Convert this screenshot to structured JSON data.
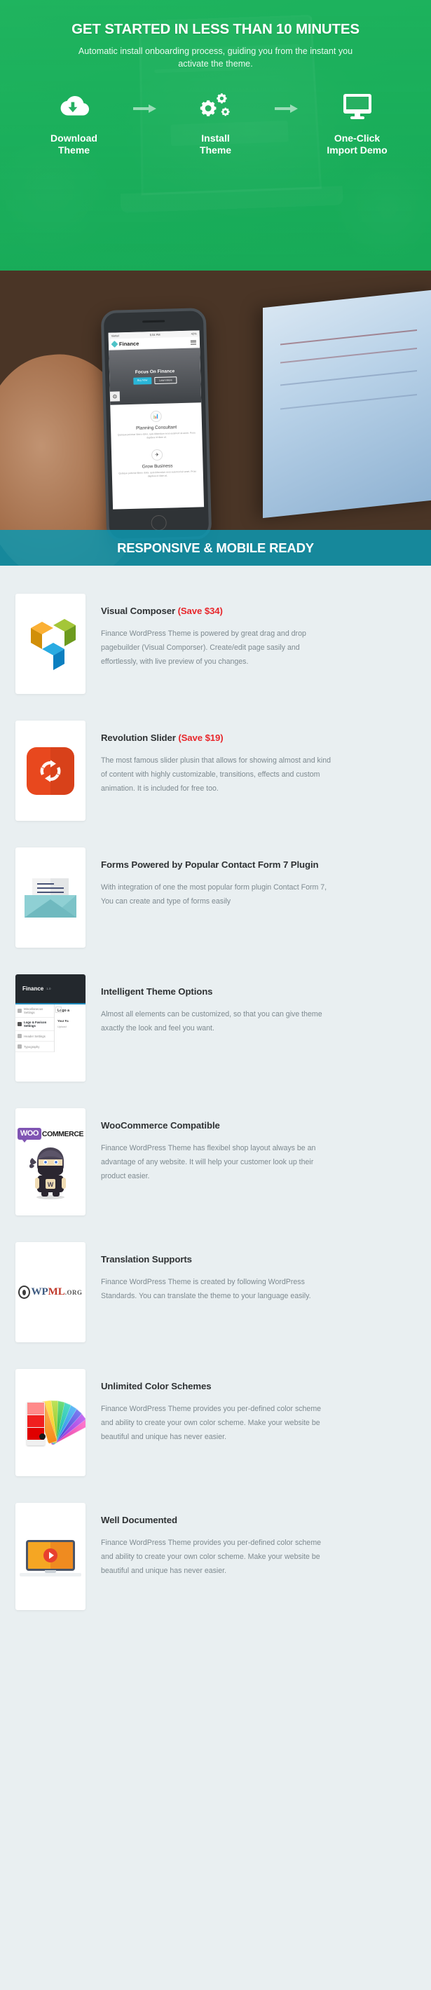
{
  "hero": {
    "title": "GET STARTED IN LESS THAN 10 MINUTES",
    "subtitle": "Automatic install onboarding process, guiding you from the instant you activate the theme.",
    "bg_color": "#20b45f",
    "steps": [
      {
        "icon": "cloud-download-icon",
        "label": "Download\nTheme"
      },
      {
        "icon": "gears-icon",
        "label": "Install\nTheme"
      },
      {
        "icon": "monitor-icon",
        "label": "One-Click\nImport Demo"
      }
    ],
    "arrow_icon": "arrow-right-icon"
  },
  "responsive": {
    "band_text": "RESPONSIVE & MOBILE READY",
    "band_color": "#0e96af",
    "phone": {
      "status_left": "Viettel",
      "status_time": "6:04 PM",
      "status_right": "42%",
      "brand": "Finance",
      "hero_heading": "Focus On Finance",
      "btn_primary": "Buy Now",
      "btn_secondary": "Learn More",
      "blocks": [
        {
          "icon": "chart-icon",
          "heading": "Planning Consultant",
          "text": "Quisque pulvinar libero dolor, quis bibendum eros euismod sit amet. Proin dapibus id diam at."
        },
        {
          "icon": "rocket-icon",
          "heading": "Grow Business",
          "text": "Quisque pulvinar libero dolor, quis bibendum eros euismod sit amet. Proin dapibus id diam at."
        }
      ]
    }
  },
  "features": [
    {
      "art": "visual-composer-logo",
      "title": "Visual Composer ",
      "save": "(Save $34)",
      "desc": "Finance WordPress Theme is powered by great drag and drop pagebuilder (Visual Comporser). Create/edit page sasily and effortlessly, with live preview of you changes."
    },
    {
      "art": "revolution-slider-logo",
      "title": "Revolution Slider ",
      "save": "(Save $19)",
      "desc": "The most famous slider plusin that allows for showing almost and kind of content with highly customizable, transitions, effects and custom animation. It is included for free too."
    },
    {
      "art": "envelope-icon",
      "title": "Forms Powered by Popular Contact Form 7 Plugin",
      "save": "",
      "desc": "With integration of one the most popular form plugin Contact Form 7, You can create and type of forms easily"
    },
    {
      "art": "theme-options-screenshot",
      "title": "Intelligent Theme Options",
      "save": "",
      "desc": "Almost all elements can be customized, so that you can give theme axactly the look and feel you want.",
      "screenshot": {
        "brand": "Finance",
        "version": "1.0",
        "nav": [
          "Miscellaneous Settings",
          "Logo & Favicon Settings",
          "Header Settings",
          "Typography"
        ],
        "active_index": 1,
        "panel_title": "Logo a",
        "field_label": "Your Fa",
        "field_hint": "Upload"
      }
    },
    {
      "art": "woocommerce-logo",
      "title": "WooCommerce Compatible",
      "save": "",
      "desc": "Finance WordPress Theme has flexibel shop layout always be an advantage of any website. It will help your customer look up their product easier.",
      "logo": {
        "mark": "WOO",
        "word": "COMMERCE",
        "ninja_letter": "W"
      }
    },
    {
      "art": "wpml-logo",
      "title": "Translation Supports",
      "save": "",
      "desc": "Finance WordPress Theme is  created by following WordPress Standards. You can translate the theme to your language easily.",
      "logo": {
        "wp": "WP",
        "ml": "ML",
        "org": ".ORG"
      }
    },
    {
      "art": "color-fan-icon",
      "title": "Unlimited Color Schemes",
      "save": "",
      "desc": "Finance WordPress Theme  provides you per-defined color scheme and ability to create your own color scheme. Make your website be beautiful and unique has never easier."
    },
    {
      "art": "video-laptop-icon",
      "title": "Well Documented",
      "save": "",
      "desc": "Finance WordPress Theme provides you per-defined color scheme and ability to create your own color scheme. Make your website be beautiful and unique has never easier."
    }
  ],
  "colors": {
    "page_bg": "#e9eff1",
    "hero_green": "#20b45f",
    "band_teal": "#0e96af",
    "accent_red": "#e8272c",
    "title_dark": "#2f3234",
    "body_gray": "#7e8a90"
  }
}
